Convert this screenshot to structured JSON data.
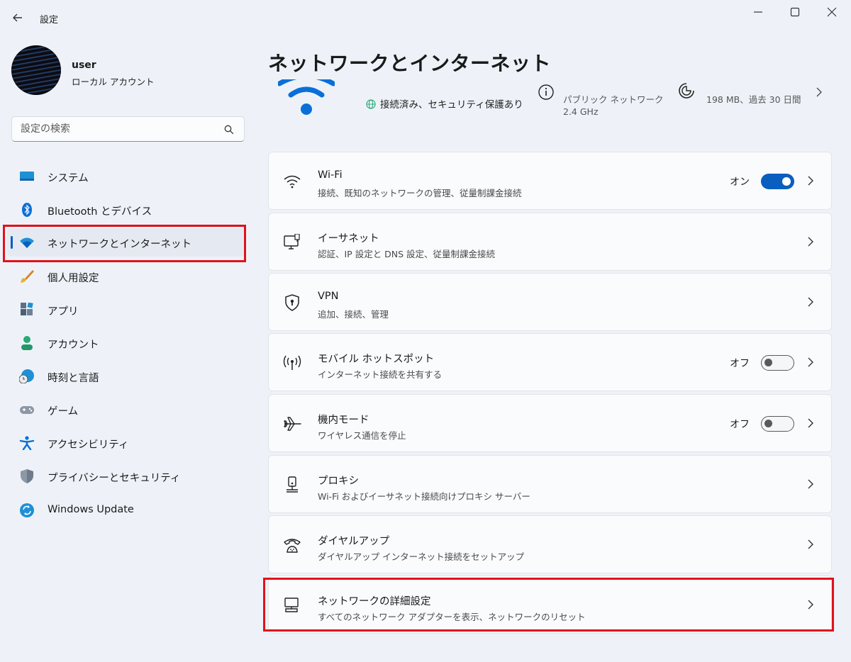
{
  "app": {
    "title": "設定"
  },
  "user": {
    "name": "user",
    "account_type": "ローカル アカウント"
  },
  "search": {
    "placeholder": "設定の検索"
  },
  "sidebar": {
    "items": [
      {
        "label": "システム",
        "icon": "monitor-icon"
      },
      {
        "label": "Bluetooth とデバイス",
        "icon": "bluetooth-icon"
      },
      {
        "label": "ネットワークとインターネット",
        "icon": "wifi-icon",
        "active": true
      },
      {
        "label": "個人用設定",
        "icon": "brush-icon"
      },
      {
        "label": "アプリ",
        "icon": "apps-icon"
      },
      {
        "label": "アカウント",
        "icon": "person-icon"
      },
      {
        "label": "時刻と言語",
        "icon": "globe-clock-icon"
      },
      {
        "label": "ゲーム",
        "icon": "gamepad-icon"
      },
      {
        "label": "アクセシビリティ",
        "icon": "accessibility-icon"
      },
      {
        "label": "プライバシーとセキュリティ",
        "icon": "shield-icon"
      },
      {
        "label": "Windows Update",
        "icon": "sync-icon"
      }
    ]
  },
  "main": {
    "title": "ネットワークとインターネット",
    "status": {
      "connection": "接続済み、セキュリティ保護あり",
      "network_type": "パブリック ネットワーク",
      "band": "2.4 GHz",
      "usage": "198 MB、過去 30 日間"
    },
    "cards": [
      {
        "title": "Wi-Fi",
        "desc": "接続、既知のネットワークの管理、従量制課金接続",
        "icon": "wifi-icon",
        "toggle_label": "オン",
        "toggle_on": true
      },
      {
        "title": "イーサネット",
        "desc": "認証、IP 設定と DNS 設定、従量制課金接続",
        "icon": "ethernet-icon"
      },
      {
        "title": "VPN",
        "desc": "追加、接続、管理",
        "icon": "vpn-shield-icon"
      },
      {
        "title": "モバイル ホットスポット",
        "desc": "インターネット接続を共有する",
        "icon": "hotspot-icon",
        "toggle_label": "オフ",
        "toggle_on": false
      },
      {
        "title": "機内モード",
        "desc": "ワイヤレス通信を停止",
        "icon": "airplane-icon",
        "toggle_label": "オフ",
        "toggle_on": false
      },
      {
        "title": "プロキシ",
        "desc": "Wi-Fi およびイーサネット接続向けプロキシ サーバー",
        "icon": "proxy-icon"
      },
      {
        "title": "ダイヤルアップ",
        "desc": "ダイヤルアップ インターネット接続をセットアップ",
        "icon": "dialup-icon"
      },
      {
        "title": "ネットワークの詳細設定",
        "desc": "すべてのネットワーク アダプターを表示、ネットワークのリセット",
        "icon": "network-pc-icon"
      }
    ]
  },
  "colors": {
    "accent": "#0a5ebf",
    "highlight": "#e1111c",
    "background": "#eef2f8"
  }
}
